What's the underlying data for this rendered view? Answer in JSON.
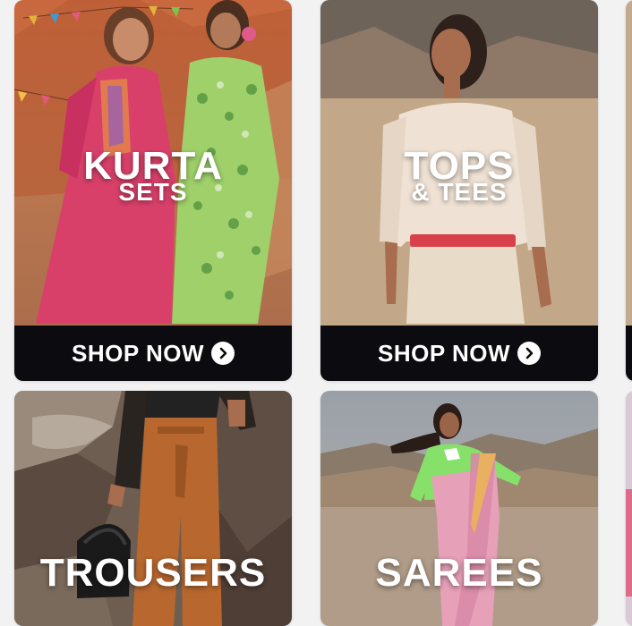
{
  "tiles": [
    {
      "title": "KURTA",
      "subtitle": "SETS",
      "cta": "SHOP NOW"
    },
    {
      "title": "TOPS",
      "subtitle": "& TEES",
      "cta": "SHOP NOW"
    },
    {
      "title": "TROUSERS"
    },
    {
      "title": "SAREES"
    }
  ],
  "icons": {
    "cta": "chevron-right-circle-icon"
  },
  "colors": {
    "cta_bar": "#0c0c10",
    "label": "#ffffff"
  }
}
